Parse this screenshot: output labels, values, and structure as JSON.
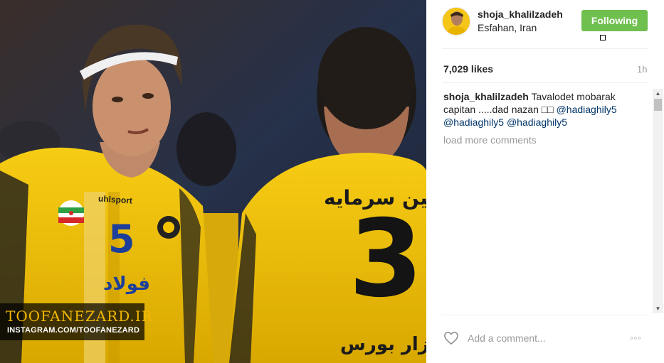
{
  "photo": {
    "alt": "Two football players in yellow Sepahan jerseys",
    "jersey_number_left": "5",
    "jersey_number_right": "3",
    "jersey_text_right_top": "بین سرمایه",
    "jersey_text_right_bottom": "گزار بورس",
    "jersey_brand": "uhlsport",
    "jersey_sponsor_left": "فولاد",
    "watermark_title": "TOOFANEZARD.IR",
    "watermark_sub": "INSTAGRAM.COM/TOOFANEZARD"
  },
  "post": {
    "username": "shoja_khalilzadeh",
    "location": "Esfahan, Iran",
    "follow_label": "Following",
    "likes": "7,029 likes",
    "time": "1h"
  },
  "caption": {
    "username": "shoja_khalilzadeh",
    "text": "Tavalodet mobarak capitan .....dad nazan □□",
    "mentions": [
      "@hadiaghily5",
      "@hadiaghily5",
      "@hadiaghily5"
    ]
  },
  "load_more": "load more comments",
  "comment_input": {
    "placeholder": "Add a comment..."
  },
  "more_label": "◦◦◦",
  "colors": {
    "follow_green": "#70c050",
    "jersey_yellow": "#f4c400",
    "mention_blue": "#003569",
    "watermark_yellow": "#f2b705"
  },
  "icons": {
    "heart": "heart-icon",
    "more": "more-options-icon"
  }
}
